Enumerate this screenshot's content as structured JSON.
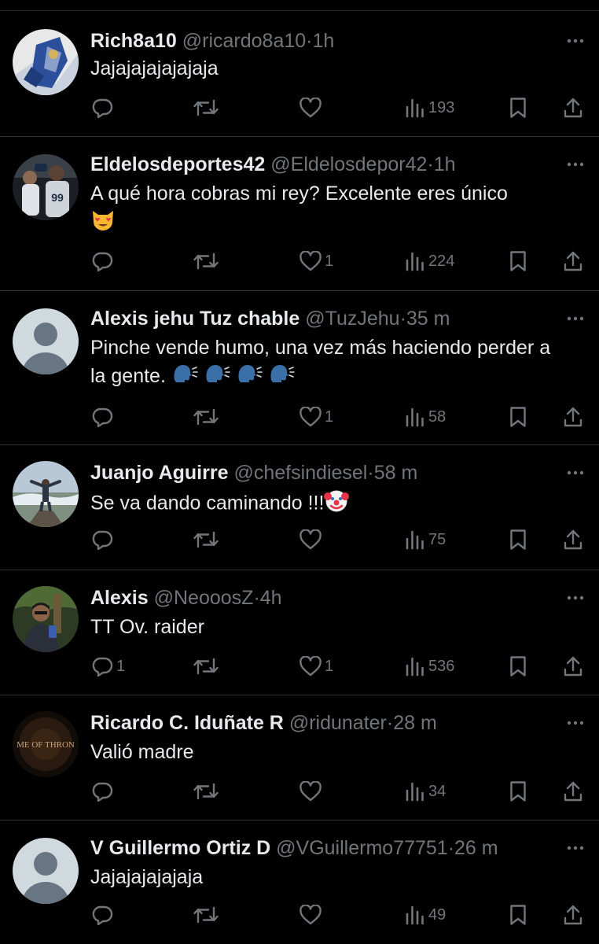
{
  "tweets": [
    {
      "name": "Rich8a10",
      "handle": "@ricardo8a10",
      "dot": "·",
      "time": "1h",
      "text": "Jajajajajajajaja",
      "emojis": [],
      "avatar": "avatar-art",
      "replies": "",
      "likes": "",
      "views": "193"
    },
    {
      "name": "Eldelosdeportes42",
      "handle": "@Eldelosdepor42",
      "dot": "·",
      "time": "1h",
      "text": "A qué hora cobras mi rey? Excelente eres único",
      "emojis": [
        "heart-eyes-cat-emoji"
      ],
      "avatar": "avatar-baseball",
      "replies": "",
      "likes": "1",
      "views": "224"
    },
    {
      "name": "Alexis jehu Tuz chable",
      "handle": "@TuzJehu",
      "dot": "·",
      "time": "35 m",
      "text": "Pinche vende humo, una vez más haciendo perder a la gente.",
      "emojis": [
        "speaking-head-emoji",
        "speaking-head-emoji",
        "speaking-head-emoji",
        "speaking-head-emoji"
      ],
      "avatar": "avatar-default",
      "replies": "",
      "likes": "1",
      "views": "58"
    },
    {
      "name": "Juanjo Aguirre",
      "handle": "@chefsindiesel",
      "dot": "·",
      "time": "58 m",
      "text": "Se va dando caminando !!!",
      "emojis": [
        "clown-face-emoji"
      ],
      "avatar": "avatar-mountain",
      "replies": "",
      "likes": "",
      "views": "75"
    },
    {
      "name": "Alexis",
      "handle": "@NeooosZ",
      "dot": "·",
      "time": "4h",
      "text": "TT Ov. raider",
      "emojis": [],
      "avatar": "avatar-selfie",
      "replies": "1",
      "likes": "1",
      "views": "536"
    },
    {
      "name": "Ricardo C. Iduñate R",
      "handle": "@ridunater",
      "dot": "·",
      "time": "28 m",
      "text": "Valió madre",
      "emojis": [],
      "avatar": "avatar-thrones",
      "avatar_text": "ME OF THRON",
      "replies": "",
      "likes": "",
      "views": "34"
    },
    {
      "name": "V Guillermo Ortiz D",
      "handle": "@VGuillermo77751",
      "dot": "·",
      "time": "26 m",
      "text": "Jajajajajajaja",
      "emojis": [],
      "avatar": "avatar-default",
      "replies": "",
      "likes": "",
      "views": "49"
    }
  ],
  "icons": {
    "reply": "reply-icon",
    "retweet": "retweet-icon",
    "like": "like-icon",
    "views": "views-icon",
    "bookmark": "bookmark-icon",
    "share": "share-icon",
    "more": "more-icon"
  },
  "colors": {
    "background": "#000000",
    "text": "#e7e9ea",
    "secondary": "#71767b",
    "divider": "#2f3336"
  }
}
